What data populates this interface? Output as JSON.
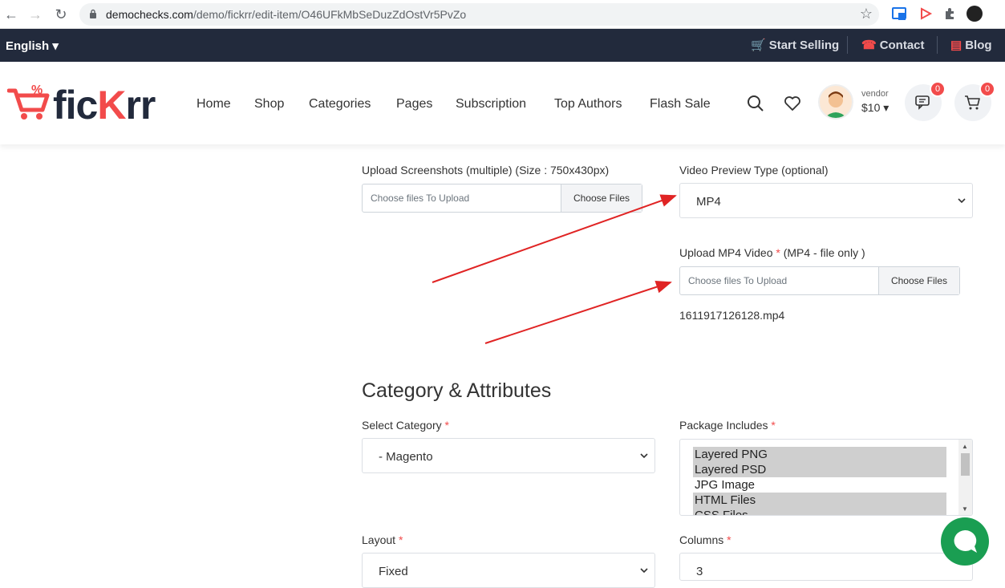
{
  "browser": {
    "url_domain": "demochecks.com",
    "url_path": "/demo/fickrr/edit-item/O46UFkMbSeDuzZdOstVr5PvZo"
  },
  "topbar": {
    "language": "English",
    "start_selling": "Start Selling",
    "contact": "Contact",
    "blog": "Blog"
  },
  "logo": {
    "part1": "fic",
    "part2": "K",
    "part3": "rr"
  },
  "nav": [
    "Home",
    "Shop",
    "Categories",
    "Pages",
    "Subscription",
    "Top Authors",
    "Flash Sale"
  ],
  "user": {
    "role": "vendor",
    "balance": "$10"
  },
  "badges": {
    "messages": "0",
    "cart": "0"
  },
  "form": {
    "screenshots_label": "Upload Screenshots (multiple) (Size : 750x430px)",
    "screenshots_placeholder": "Choose files To Upload",
    "choose_files": "Choose Files",
    "video_type_label": "Video Preview Type (optional)",
    "video_type_value": "MP4",
    "mp4_label": "Upload MP4 Video",
    "mp4_hint": "(MP4 - file only )",
    "mp4_placeholder": "Choose files To Upload",
    "mp4_filename": "1611917126128.mp4",
    "section_heading": "Category & Attributes",
    "category_label": "Select Category",
    "category_value": "- Magento",
    "package_label": "Package Includes",
    "package_options": [
      "Layered PNG",
      "Layered PSD",
      "JPG Image",
      "HTML Files",
      "CSS Files"
    ],
    "package_selected": [
      true,
      true,
      false,
      true,
      true
    ],
    "layout_label": "Layout",
    "layout_value": "Fixed",
    "columns_label": "Columns",
    "columns_value": "3",
    "required_mark": "*"
  },
  "colors": {
    "accent": "#f24b4b",
    "topbar": "#222a3c",
    "chat": "#1a9e52",
    "arrow": "#e02424"
  }
}
